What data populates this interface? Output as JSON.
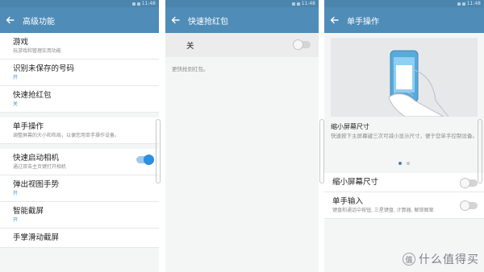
{
  "status_bar": {
    "clock_text": "11:48"
  },
  "panel1": {
    "title": "高级功能",
    "items": [
      {
        "title": "游戏",
        "subtitle": "玩游戏和管理实用功能"
      },
      {
        "title": "识别未保存的号码",
        "subtitle": "开"
      },
      {
        "title": "快速抢红包",
        "subtitle": "关"
      },
      {
        "title": "单手操作",
        "subtitle": "调整屏幕的大小和布局，以便您用单手操作设备。"
      },
      {
        "title": "快速启动相机",
        "subtitle": "通过双击主页键打开相机",
        "toggle": true
      },
      {
        "title": "弹出视图手势",
        "subtitle": "开"
      },
      {
        "title": "智能截屏",
        "subtitle": "开"
      },
      {
        "title": "手掌滑动截屏",
        "subtitle": ""
      }
    ]
  },
  "panel2": {
    "title": "快速抢红包",
    "switch_label": "关",
    "switch_on": false,
    "description": "更快抢到红包。"
  },
  "panel3": {
    "title": "单手操作",
    "feature_title": "缩小屏幕尺寸",
    "feature_description": "快速按下主屏幕键三次可减小显示尺寸，便于您单手控制设备。",
    "page_dots": 2,
    "active_dot": 0,
    "items": [
      {
        "title": "缩小屏幕尺寸",
        "subtitle": "",
        "toggle": false
      },
      {
        "title": "单手输入",
        "subtitle": "键盘和通话中按钮, 三星键盘, 计算器, 解锁图案",
        "toggle": false
      }
    ]
  },
  "watermark": {
    "text": "什么值得买",
    "logo_glyph": "值"
  },
  "colors": {
    "appbar": "#4f8cb8",
    "statusbar": "#4b84ad",
    "accent": "#2d8fe0",
    "on_text": "#3f8fd2"
  }
}
